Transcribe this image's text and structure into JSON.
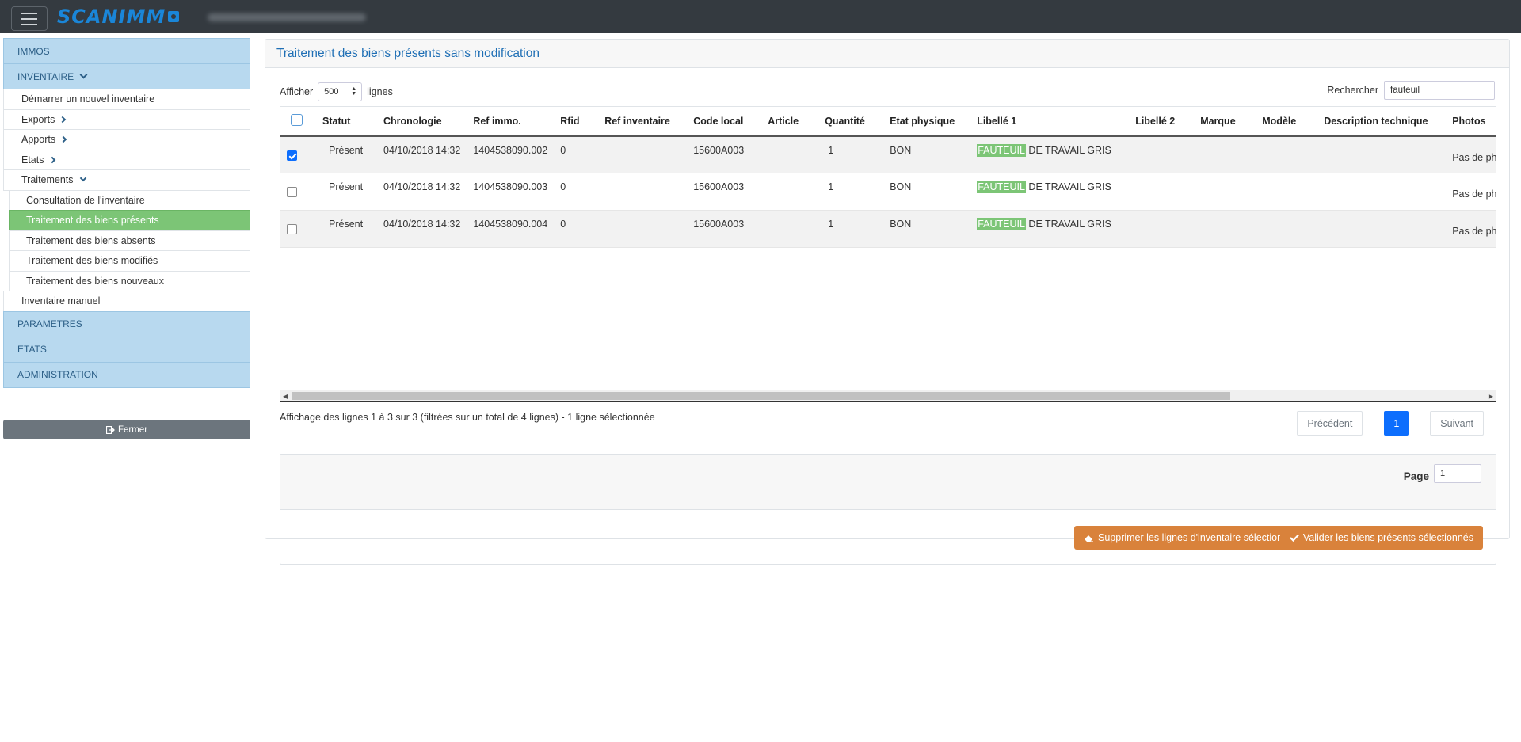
{
  "brand": {
    "name": "SCANIMM"
  },
  "sidebar": {
    "immos": "IMMOS",
    "inventaire": "INVENTAIRE",
    "inventaire_items": {
      "demarrer": "Démarrer un nouvel inventaire",
      "exports": "Exports",
      "apports": "Apports",
      "etats": "Etats",
      "traitements": "Traitements",
      "traitements_items": [
        "Consultation de l'inventaire",
        "Traitement des biens présents",
        "Traitement des biens absents",
        "Traitement des biens modifiés",
        "Traitement des biens nouveaux"
      ],
      "manuel": "Inventaire manuel"
    },
    "parametres": "PARAMETRES",
    "etats_sec": "ETATS",
    "administration": "ADMINISTRATION",
    "close_label": "Fermer"
  },
  "main": {
    "title": "Traitement des biens présents sans modification",
    "show_prefix": "Afficher",
    "show_value": "500",
    "show_suffix": "lignes",
    "search_label": "Rechercher",
    "search_value": "fauteuil",
    "columns": [
      "Statut",
      "Chronologie",
      "Ref immo.",
      "Rfid",
      "Ref inventaire",
      "Code local",
      "Article",
      "Quantité",
      "Etat physique",
      "Libellé 1",
      "Libellé 2",
      "Marque",
      "Modèle",
      "Description technique",
      "Photos"
    ],
    "rows": [
      {
        "statut": "Présent",
        "chrono": "04/10/2018 14:32",
        "ref": "1404538090.002",
        "rfid": "0",
        "code": "15600A003",
        "qte": "1",
        "etat": "BON",
        "lib_hl": "FAUTEUIL",
        "lib_rest": " DE TRAVAIL GRIS",
        "photo": "Pas de phot"
      },
      {
        "statut": "Présent",
        "chrono": "04/10/2018 14:32",
        "ref": "1404538090.003",
        "rfid": "0",
        "code": "15600A003",
        "qte": "1",
        "etat": "BON",
        "lib_hl": "FAUTEUIL",
        "lib_rest": " DE TRAVAIL GRIS",
        "photo": "Pas de phot"
      },
      {
        "statut": "Présent",
        "chrono": "04/10/2018 14:32",
        "ref": "1404538090.004",
        "rfid": "0",
        "code": "15600A003",
        "qte": "1",
        "etat": "BON",
        "lib_hl": "FAUTEUIL",
        "lib_rest": " DE TRAVAIL GRIS",
        "photo": "Pas de phot"
      }
    ],
    "info": "Affichage des lignes 1 à 3 sur 3 (filtrées sur un total de 4 lignes) - 1 ligne sélectionnée",
    "pager": {
      "prev": "Précédent",
      "current": "1",
      "next": "Suivant"
    },
    "page_label": "Page",
    "page_value": "1",
    "delete_label": "Supprimer les lignes d'inventaire sélectionnées",
    "validate_label": "Valider les biens présents sélectionnés"
  },
  "colors": {
    "accent": "#1f6fb5",
    "active_green": "#7cc576",
    "action_orange": "#d9823b",
    "section_blue": "#b8d9ef"
  }
}
